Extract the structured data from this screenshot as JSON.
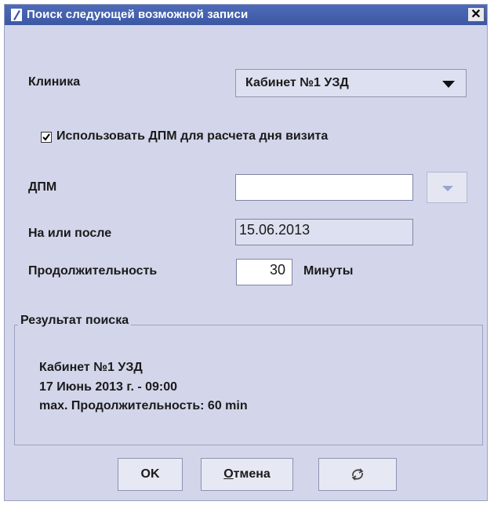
{
  "window": {
    "title": "Поиск следующей возможной записи",
    "close_glyph": "✕"
  },
  "form": {
    "clinic_label": "Клиника",
    "clinic_value": "Кабинет №1 УЗД",
    "use_dpm_label": "Использовать ДПМ для расчета дня визита",
    "use_dpm_checked": true,
    "dpm_label": "ДПМ",
    "dpm_value": "",
    "after_label": "На или после",
    "after_value": "15.06.2013",
    "duration_label": "Продолжительность",
    "duration_value": "30",
    "duration_unit": "Минуты"
  },
  "result": {
    "title": "Результат поиска",
    "line1": "Кабинет №1 УЗД",
    "line2": "17 Июнь 2013 г. - 09:00",
    "line3": "max. Продолжительность: 60 min"
  },
  "buttons": {
    "ok_label": "OK",
    "cancel_first": "О",
    "cancel_rest": "тмена",
    "extra_icon": "refresh-icon"
  },
  "colors": {
    "window_bg": "#d3d6ea",
    "titlebar": "#3c58a3"
  }
}
